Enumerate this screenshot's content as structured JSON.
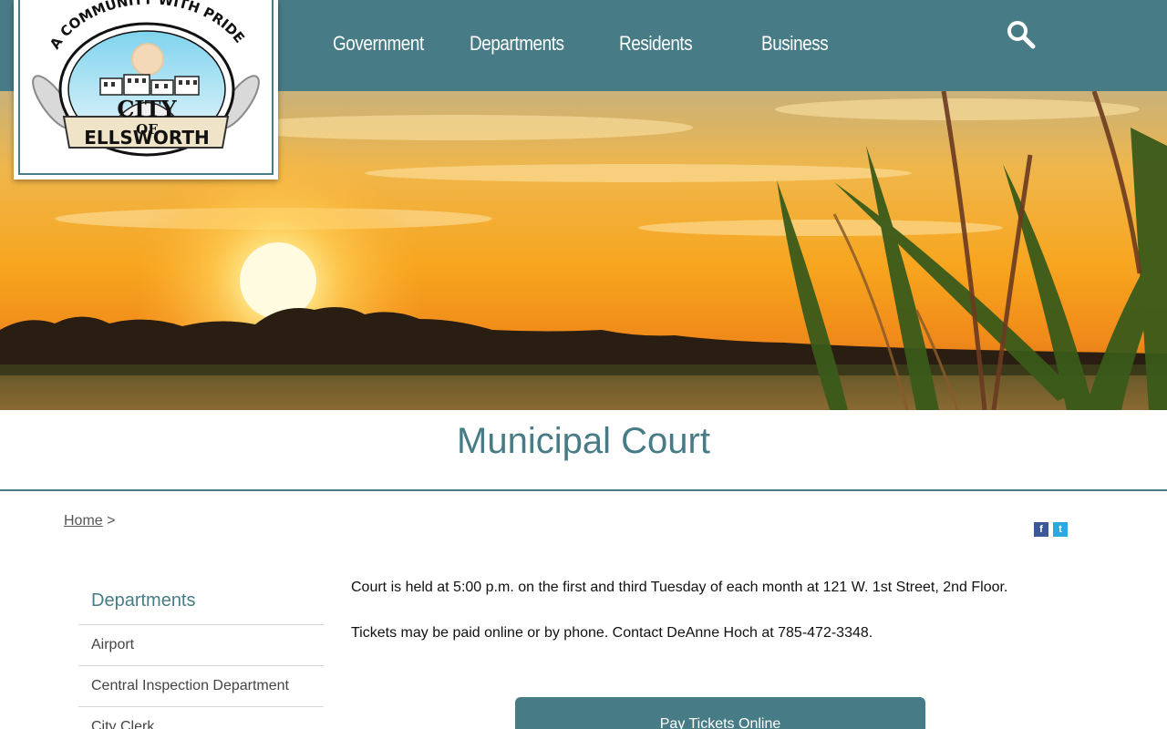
{
  "nav": {
    "items": [
      {
        "label": "Government"
      },
      {
        "label": "Departments"
      },
      {
        "label": "Residents"
      },
      {
        "label": "Business"
      }
    ]
  },
  "logo": {
    "arc_text": "A COMMUNITY WITH PRIDE",
    "line1": "CITY",
    "line2": "OF",
    "line3": "ELLSWORTH"
  },
  "page": {
    "title": "Municipal Court"
  },
  "breadcrumb": {
    "home": "Home",
    "separator": ">"
  },
  "social": {
    "facebook": "f",
    "twitter": "t"
  },
  "sidebar": {
    "heading": "Departments",
    "items": [
      {
        "label": "Airport"
      },
      {
        "label": "Central Inspection Department"
      },
      {
        "label": "City Clerk"
      }
    ]
  },
  "content": {
    "paragraph1": "Court is held at 5:00 p.m. on the first and third Tuesday of each month at 121 W. 1st Street, 2nd Floor.",
    "paragraph2": "Tickets may be paid online or by phone. Contact DeAnne Hoch at 785-472-3348.",
    "pay_button": "Pay Tickets Online"
  },
  "colors": {
    "brand": "#477c87"
  }
}
